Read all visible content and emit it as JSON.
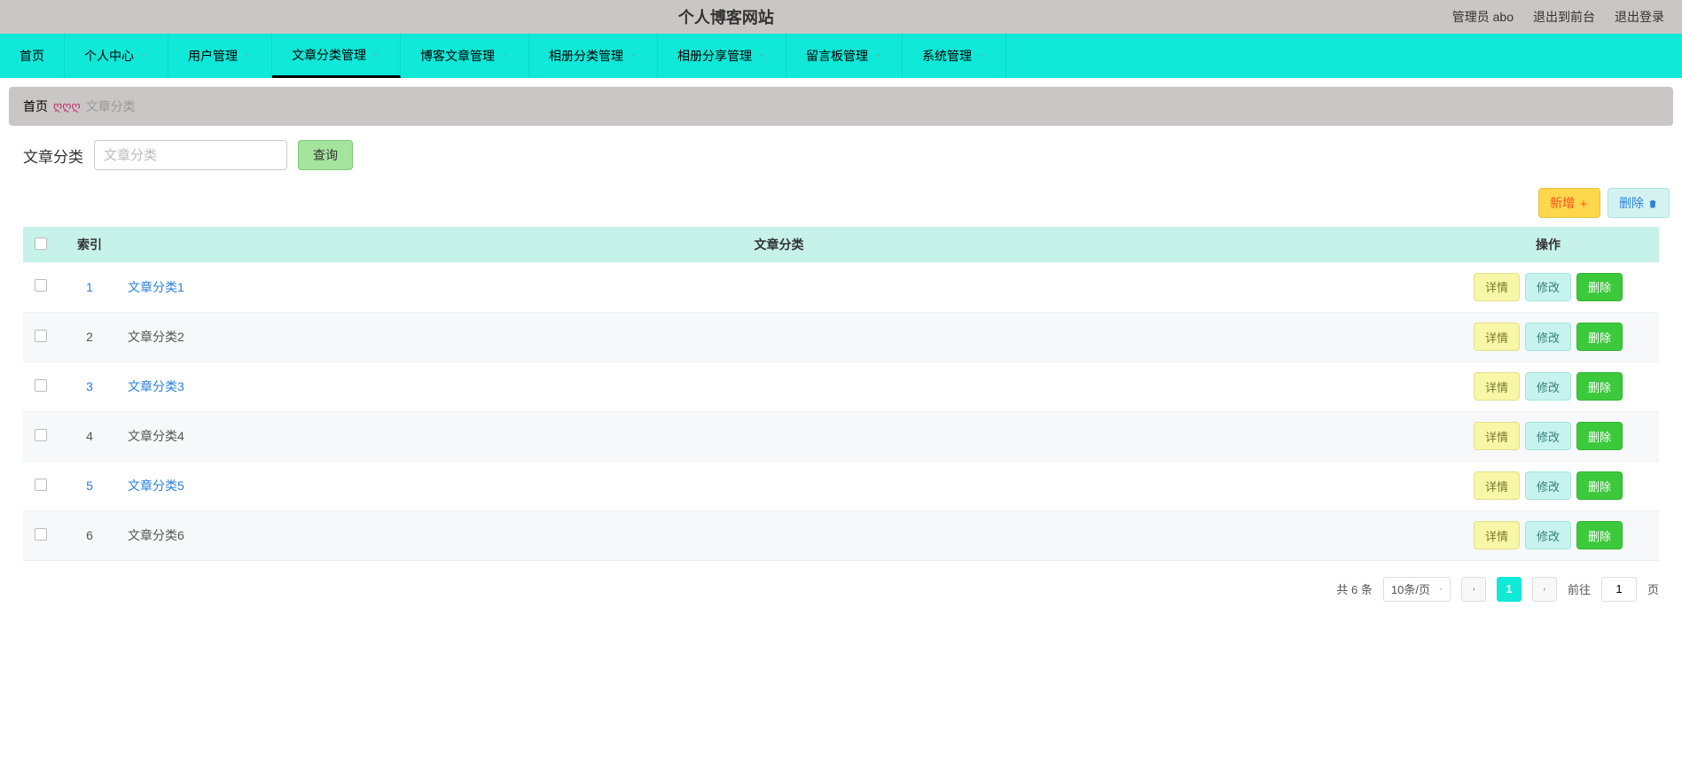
{
  "topbar": {
    "title": "个人博客网站",
    "user_info": "管理员 abo",
    "logout_front": "退出到前台",
    "logout": "退出登录"
  },
  "nav": {
    "items": [
      {
        "label": "首页",
        "dropdown": false,
        "active": false
      },
      {
        "label": "个人中心",
        "dropdown": true,
        "active": false
      },
      {
        "label": "用户管理",
        "dropdown": true,
        "active": false
      },
      {
        "label": "文章分类管理",
        "dropdown": true,
        "active": true
      },
      {
        "label": "博客文章管理",
        "dropdown": true,
        "active": false
      },
      {
        "label": "相册分类管理",
        "dropdown": true,
        "active": false
      },
      {
        "label": "相册分享管理",
        "dropdown": true,
        "active": false
      },
      {
        "label": "留言板管理",
        "dropdown": true,
        "active": false
      },
      {
        "label": "系统管理",
        "dropdown": true,
        "active": false
      }
    ]
  },
  "breadcrumb": {
    "home": "首页",
    "deco": "ღღღ",
    "current": "文章分类"
  },
  "filter": {
    "label": "文章分类",
    "placeholder": "文章分类",
    "value": "",
    "search_btn": "查询"
  },
  "actions": {
    "add": "新增",
    "delete": "删除"
  },
  "table": {
    "headers": {
      "index": "索引",
      "category": "文章分类",
      "ops": "操作"
    },
    "row_buttons": {
      "detail": "详情",
      "edit": "修改",
      "delete": "删除"
    },
    "rows": [
      {
        "idx": "1",
        "name": "文章分类1",
        "linked": true
      },
      {
        "idx": "2",
        "name": "文章分类2",
        "linked": false
      },
      {
        "idx": "3",
        "name": "文章分类3",
        "linked": true
      },
      {
        "idx": "4",
        "name": "文章分类4",
        "linked": false
      },
      {
        "idx": "5",
        "name": "文章分类5",
        "linked": true
      },
      {
        "idx": "6",
        "name": "文章分类6",
        "linked": false
      }
    ]
  },
  "pagination": {
    "total_text": "共 6 条",
    "per_page": "10条/页",
    "current_page": "1",
    "goto_label_pre": "前往",
    "goto_value": "1",
    "goto_label_post": "页"
  }
}
